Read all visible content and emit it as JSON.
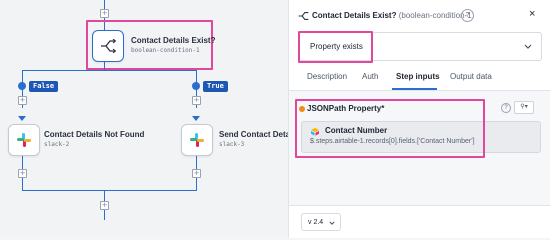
{
  "canvas": {
    "condition_node": {
      "title": "Contact Details Exist?",
      "subtitle": "boolean-condition-1",
      "icon": "branch-icon"
    },
    "false_badge": "False",
    "true_badge": "True",
    "left_node": {
      "title": "Contact Details Not Found",
      "subtitle": "slack-2",
      "icon": "slack-icon"
    },
    "right_node": {
      "title": "Send Contact Details",
      "subtitle": "slack-3",
      "icon": "slack-icon"
    },
    "plus_symbol": "+"
  },
  "panel": {
    "header": {
      "title": "Contact Details Exist?",
      "subtitle": "(boolean-condition-1)",
      "help": "?",
      "close": "×"
    },
    "condition_select": {
      "value": "Property exists"
    },
    "tabs": [
      {
        "label": "Description",
        "active": false
      },
      {
        "label": "Auth",
        "active": false
      },
      {
        "label": "Step inputs",
        "active": true
      },
      {
        "label": "Output data",
        "active": false
      }
    ],
    "property": {
      "label": "JSONPath Property*",
      "value_title": "Contact Number",
      "value_path": "$.steps.airtable-1.records[0].fields.['Contact Number']"
    },
    "footer": {
      "version": "v 2.4"
    }
  },
  "colors": {
    "accent": "#2a6fd0",
    "highlight": "#e0489d",
    "required_dot": "#f08c1c"
  }
}
